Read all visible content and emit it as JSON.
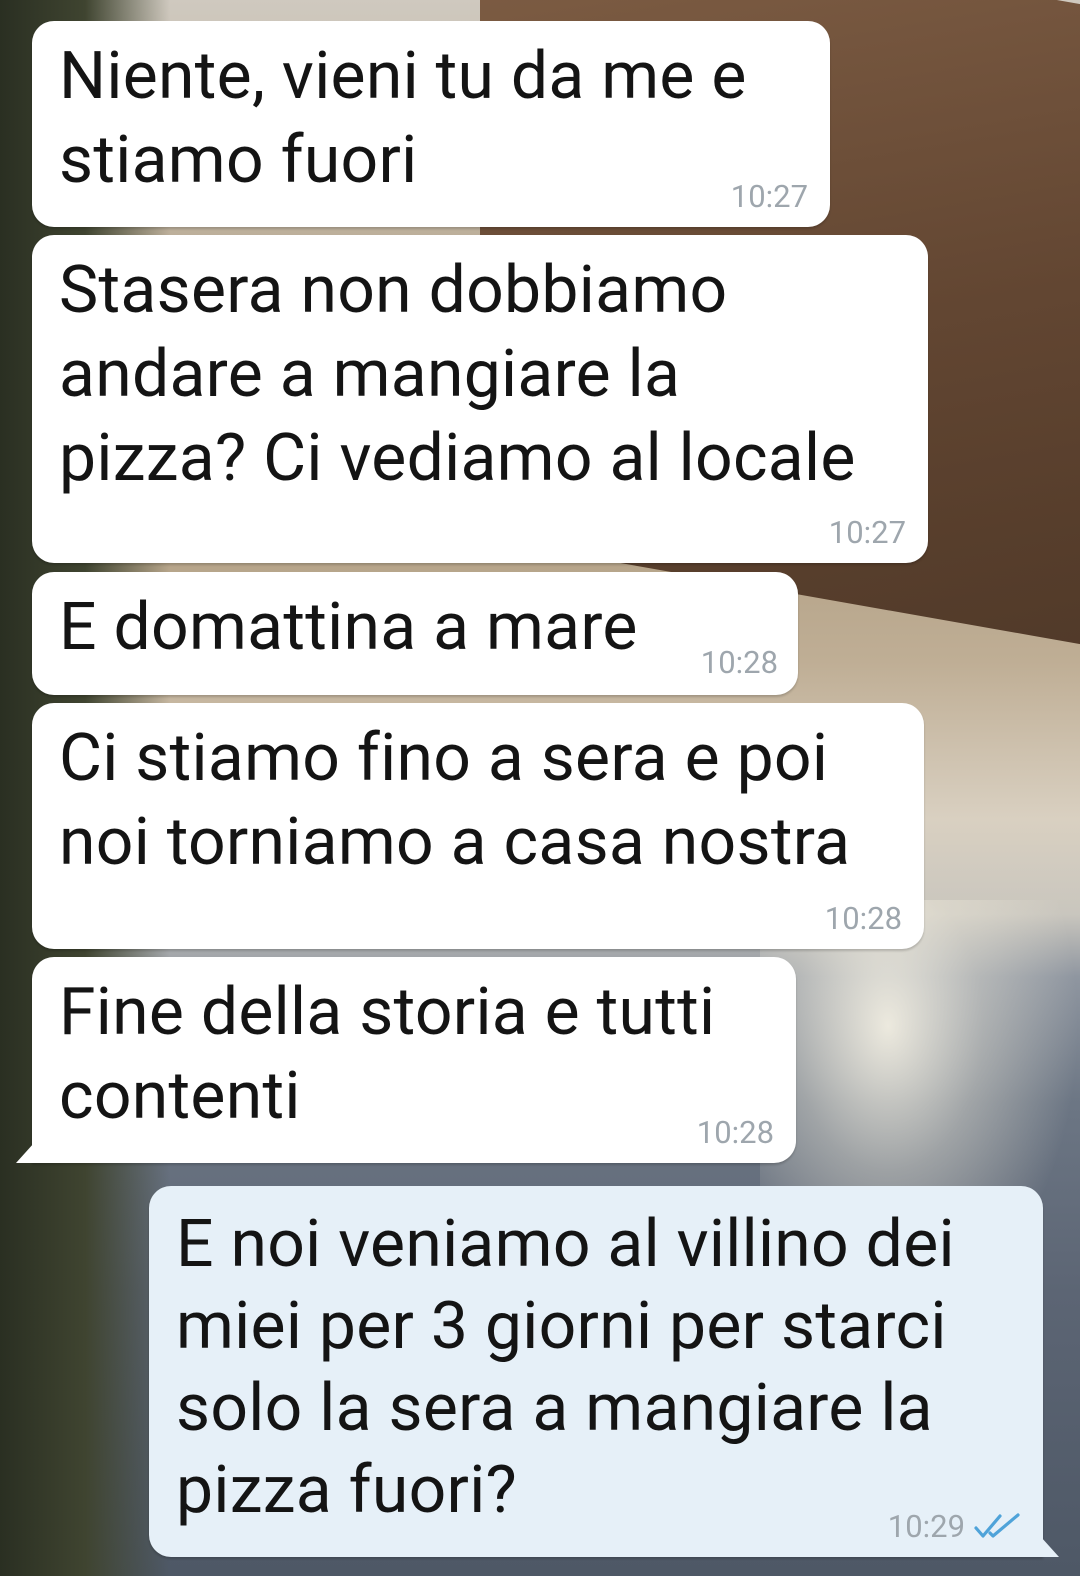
{
  "messages": [
    {
      "direction": "incoming",
      "text": "Niente, vieni tu da me e\nstiamo fuori",
      "time": "10:27"
    },
    {
      "direction": "incoming",
      "text": "Stasera non dobbiamo\nandare a mangiare la\npizza? Ci vediamo al locale",
      "time": "10:27"
    },
    {
      "direction": "incoming",
      "text": "E domattina a mare",
      "time": "10:28"
    },
    {
      "direction": "incoming",
      "text": "Ci stiamo fino a sera e poi\nnoi torniamo a casa nostra",
      "time": "10:28"
    },
    {
      "direction": "incoming",
      "text": "Fine della storia e tutti\ncontenti",
      "time": "10:28"
    },
    {
      "direction": "outgoing",
      "text": "E noi veniamo al villino dei\nmiei per 3 giorni per starci\nsolo la sera a mangiare la\npizza fuori?",
      "time": "10:29",
      "status_icon": "double-check-read-icon"
    }
  ],
  "colors": {
    "incoming_bubble": "#ffffff",
    "outgoing_bubble": "#e6f0f8",
    "timestamp": "#9ea6ad",
    "read_ticks": "#4fa3d9"
  }
}
